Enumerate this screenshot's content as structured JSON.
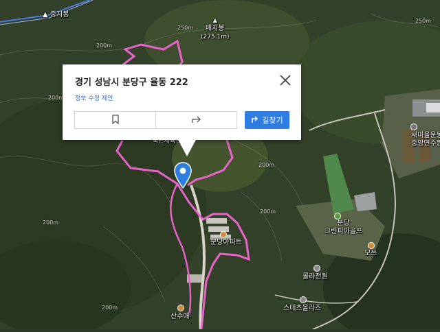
{
  "popup": {
    "address": "경기 성남시 분당구 율동 222",
    "edit_link": "정보 수정 제안",
    "route_label": "길찾기",
    "bookmark_icon": "bookmark-icon",
    "share_icon": "share-icon",
    "close_icon": "close-icon"
  },
  "map": {
    "style": "satellite",
    "route_color": "#e864c8",
    "peaks": [
      {
        "name": "중지봉",
        "elev": ""
      },
      {
        "name": "매지봉",
        "elev": "(275.1m)"
      }
    ],
    "contours": [
      "250m",
      "200m",
      "200m",
      "250m",
      "200m",
      "200m",
      "200m",
      "200m"
    ],
    "places": [
      {
        "name": "새마을운동중앙연수원",
        "line1": "새마을운동",
        "line2": "중앙연수원"
      },
      {
        "name": "분당 그린피아골프",
        "line1": "분당",
        "line2": "그린피아골프"
      },
      {
        "name": "분당아파트",
        "line1": "분당아파트",
        "line2": ""
      },
      {
        "name": "모쓰",
        "line1": "모쓰",
        "line2": ""
      },
      {
        "name": "콜라전원",
        "line1": "콜라전원",
        "line2": ""
      },
      {
        "name": "스테츠올라즈",
        "line1": "스테츠올라즈",
        "line2": ""
      },
      {
        "name": "산수애",
        "line1": "산수애",
        "line2": ""
      },
      {
        "name": "국민체육센터",
        "line1": "국민체육센터",
        "line2": ""
      }
    ]
  }
}
